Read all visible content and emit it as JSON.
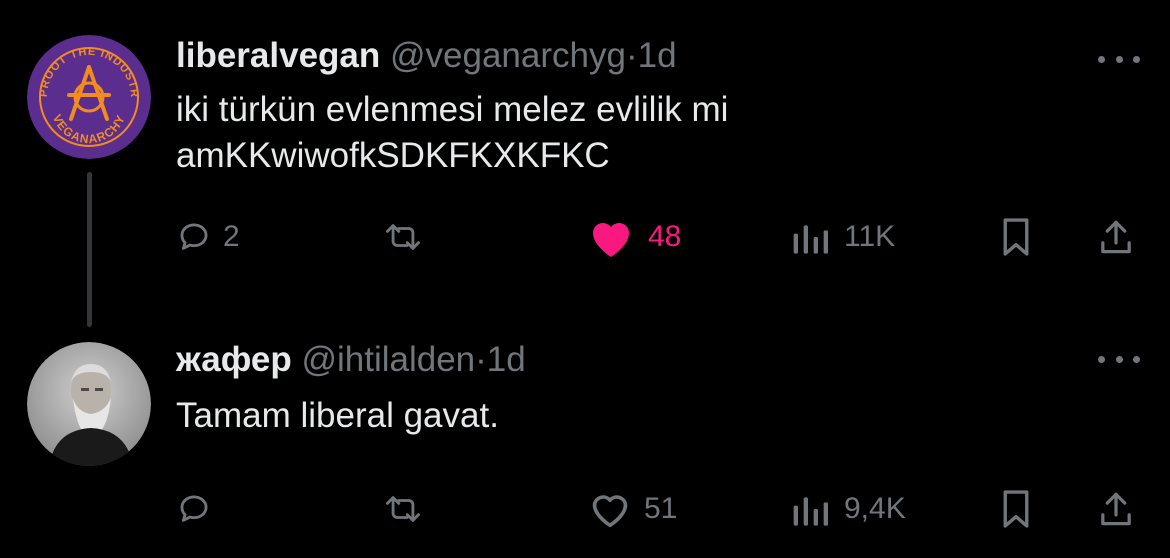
{
  "tweets": [
    {
      "display_name": "liberalvegan",
      "handle": "@veganarchyg",
      "separator": "·",
      "time": "1d",
      "text": "iki türkün evlenmesi melez evlilik mi\namKKwiwofkSDKFKXKFKC",
      "avatar_text_top": "UPROOT THE INDUSTRY",
      "avatar_text_bottom": "VEGANARCHY",
      "stats": {
        "replies": "2",
        "reposts": "",
        "likes": "48",
        "views": "11K"
      },
      "liked": true
    },
    {
      "display_name": "жафер",
      "handle": "@ihtilalden",
      "separator": "·",
      "time": "1d",
      "text": "Tamam liberal gavat.",
      "stats": {
        "replies": "",
        "reposts": "",
        "likes": "51",
        "views": "9,4K"
      },
      "liked": false
    }
  ],
  "colors": {
    "background": "#000000",
    "text": "#e7e9ea",
    "secondary": "#71767b",
    "like": "#f91880",
    "thread_line": "#333639",
    "avatar_purple": "#5b2d8e",
    "avatar_orange": "#f28c1e"
  },
  "icons": [
    "reply-icon",
    "repost-icon",
    "like-icon",
    "views-icon",
    "bookmark-icon",
    "share-icon",
    "more-icon"
  ]
}
